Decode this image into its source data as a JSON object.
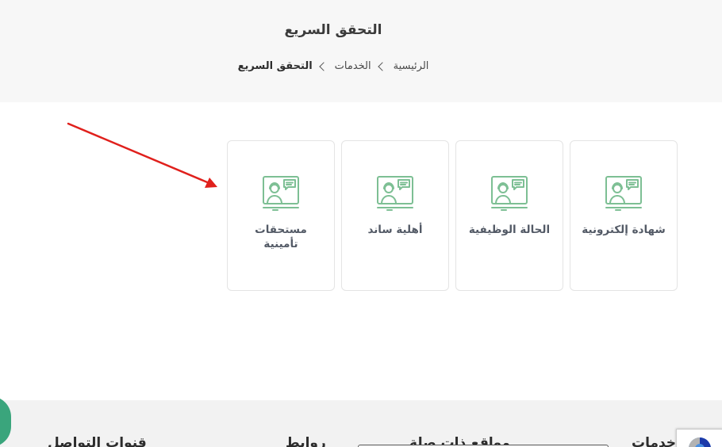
{
  "header": {
    "title": "التحقق السريع",
    "breadcrumb": {
      "home": "الرئيسية",
      "services": "الخدمات",
      "current": "التحقق السريع"
    }
  },
  "cards": [
    {
      "label": "شهادة إلكترونية",
      "icon": "support-agent-screen-icon"
    },
    {
      "label": "الحالة الوظيفية",
      "icon": "support-agent-screen-icon"
    },
    {
      "label": "أهلية ساند",
      "icon": "support-agent-screen-icon"
    },
    {
      "label": "مستحقات تأمينية",
      "icon": "support-agent-screen-icon"
    }
  ],
  "footer": {
    "services_heading": "خدمات",
    "related_sites_heading": "مواقع ذات صلة",
    "links_heading": "روابط",
    "contact_heading": "قنوات التواصل"
  },
  "colors": {
    "accent_green": "#3aa57c",
    "icon_green": "#7dbf94",
    "annotation_red": "#e0201c"
  }
}
